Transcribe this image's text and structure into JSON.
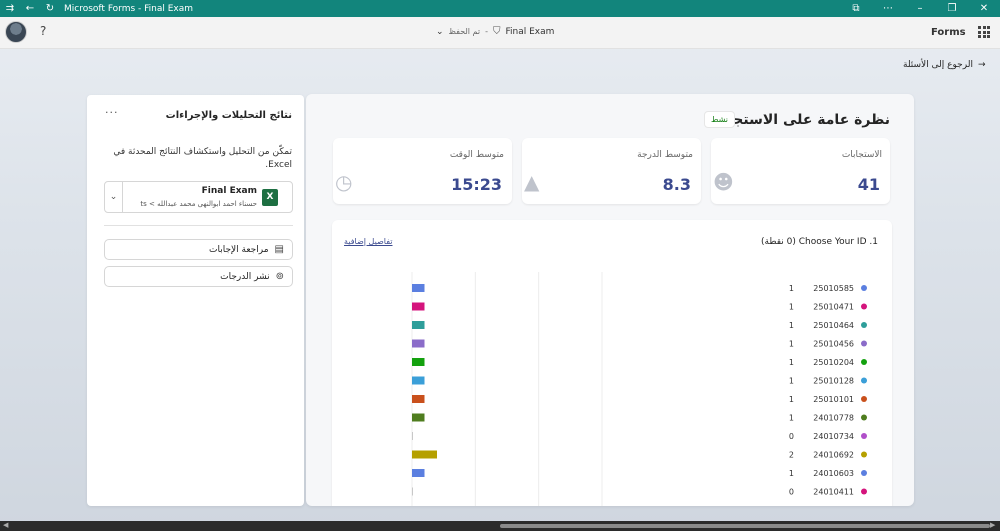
{
  "window": {
    "title": "Microsoft Forms - Final Exam"
  },
  "header": {
    "form_name": "Final Exam",
    "save_status": "تم الحفظ",
    "brand": "Forms"
  },
  "back_link": "الرجوع إلى الأسئلة",
  "overview": {
    "title": "نظرة عامة على الاستجابات",
    "status_badge": "نشط",
    "stats": [
      {
        "label": "الاستجابات",
        "value": "41",
        "icon": "people-icon"
      },
      {
        "label": "متوسط الدرجة",
        "value": "8.3",
        "icon": "graduation-cap-icon"
      },
      {
        "label": "متوسط الوقت",
        "value": "15:23",
        "icon": "alarm-clock-icon"
      }
    ]
  },
  "question": {
    "number": "1.",
    "title": "Choose Your ID",
    "points": "(0 نقطة)",
    "more_details": "تفاصيل إضافية"
  },
  "chart_data": {
    "type": "bar",
    "orientation": "horizontal",
    "categories": [
      "25010585",
      "25010471",
      "25010464",
      "25010456",
      "25010204",
      "25010128",
      "25010101",
      "24010778",
      "24010734",
      "24010692",
      "24010603",
      "24010411"
    ],
    "values": [
      1,
      1,
      1,
      1,
      1,
      1,
      1,
      1,
      0,
      2,
      1,
      0
    ],
    "colors": [
      "#5b7fe0",
      "#d4147c",
      "#2e9e9a",
      "#8b6cc9",
      "#13a10e",
      "#3b9fd8",
      "#c9501c",
      "#4f7d1f",
      "#b04fc9",
      "#b5a000",
      "#5b7fe0",
      "#d4147c"
    ],
    "xlim": [
      0,
      12
    ]
  },
  "side_panel": {
    "title": "نتائج التحليلات والإجراءات",
    "description": "تمكّن من التحليل واستكشاف النتائج المحدثة في Excel.",
    "file": {
      "name": "Final Exam",
      "path": "حسناء احمد ابوالنهى محمد عبدالله > ts",
      "icon": "excel-icon"
    },
    "actions": [
      {
        "label": "مراجعة الإجابات",
        "icon": "review-icon"
      },
      {
        "label": "نشر الدرجات",
        "icon": "publish-icon"
      }
    ]
  }
}
